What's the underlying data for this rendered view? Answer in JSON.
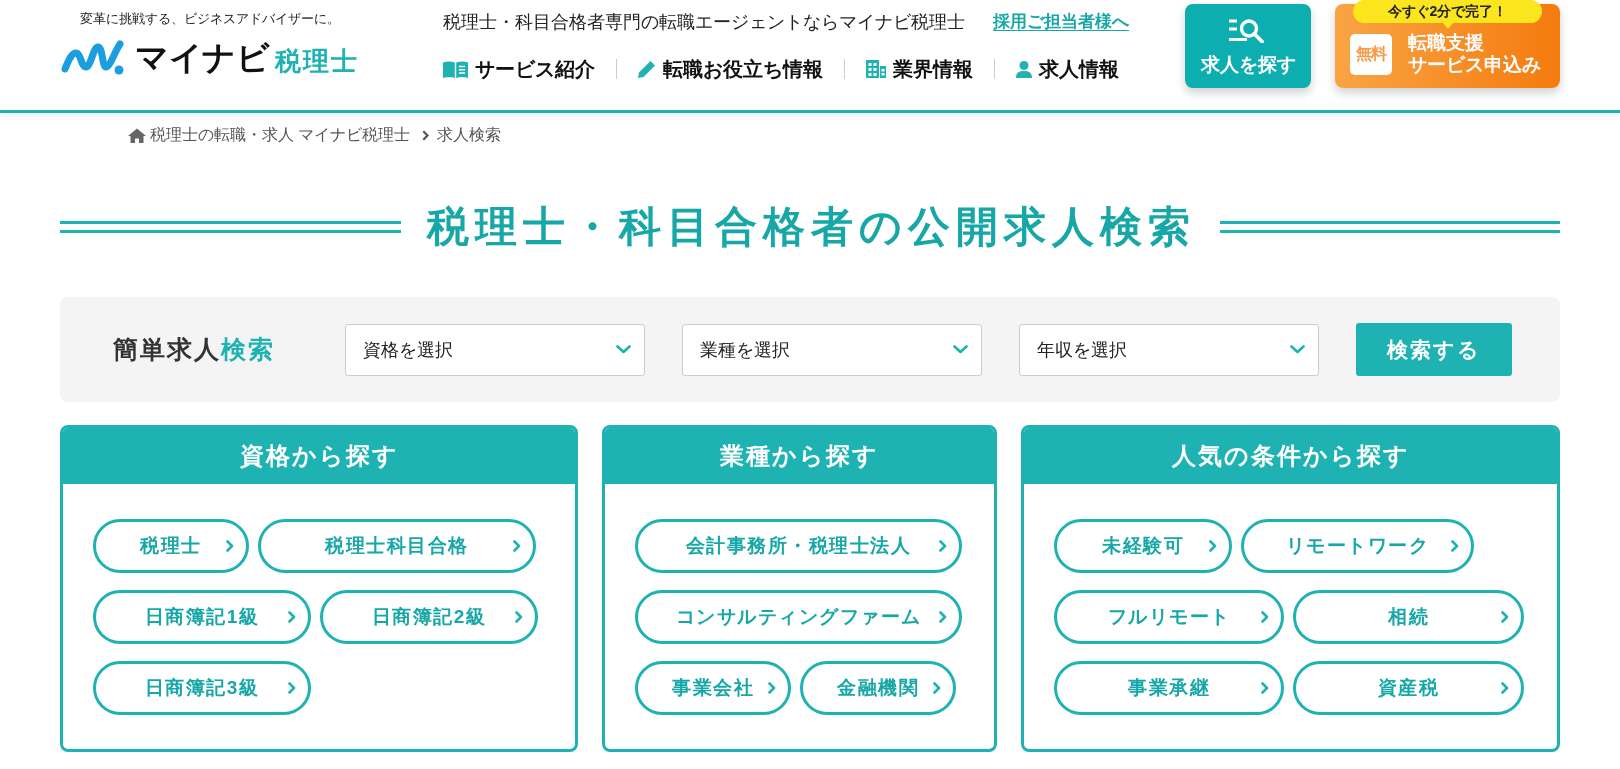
{
  "header": {
    "tagline": "変革に挑戦する、ビジネスアドバイザーに。",
    "logo": {
      "name": "マイナビ",
      "suffix": "税理士"
    },
    "headline": "税理士・科目合格者専門の転職エージェントならマイナビ税理士",
    "employer_link": "採用ご担当者様へ",
    "nav": [
      "サービス紹介",
      "転職お役立ち情報",
      "業界情報",
      "求人情報"
    ],
    "search_button": "求人を探す",
    "apply_button": {
      "badge": "今すぐ2分で完了！",
      "tag": "無料",
      "lines": [
        "転職支援",
        "サービス申込み"
      ]
    }
  },
  "breadcrumb": {
    "links": [
      "税理士の転職・求人 マイナビ税理士"
    ],
    "current": "求人検索"
  },
  "page_title": "税理士・科目合格者の公開求人検索",
  "quick_search": {
    "label": "簡単求人",
    "label_accent": "検索",
    "selects": [
      {
        "placeholder": "資格を選択"
      },
      {
        "placeholder": "業種を選択"
      },
      {
        "placeholder": "年収を選択"
      }
    ],
    "button": "検索する"
  },
  "categories": [
    {
      "title": "資格から探す",
      "links": [
        "税理士",
        "税理士科目合格",
        "日商簿記1級",
        "日商簿記2級",
        "日商簿記3級"
      ]
    },
    {
      "title": "業種から探す",
      "links": [
        "会計事務所・税理士法人",
        "コンサルティングファーム",
        "事業会社",
        "金融機関"
      ]
    },
    {
      "title": "人気の条件から探す",
      "links": [
        "未経験可",
        "リモートワーク",
        "フルリモート",
        "相続",
        "事業承継",
        "資産税"
      ]
    }
  ]
}
